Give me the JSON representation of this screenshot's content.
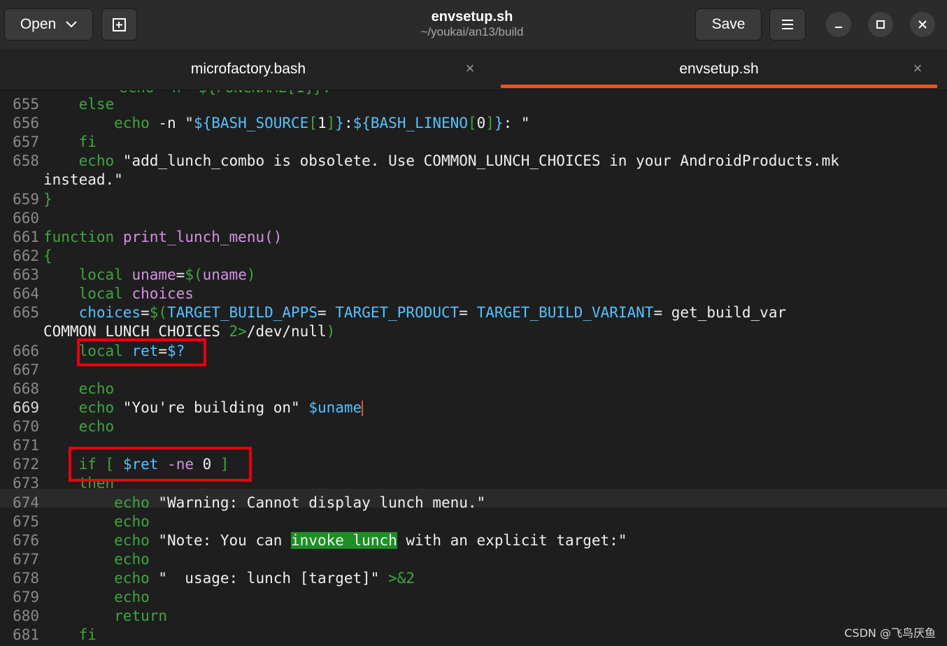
{
  "header": {
    "open_label": "Open",
    "new_tab_icon": "new-document-icon",
    "title": "envsetup.sh",
    "subtitle": "~/youkai/an13/build",
    "save_label": "Save",
    "menu_icon": "hamburger-menu-icon",
    "minimize_icon": "minimize-icon",
    "maximize_icon": "maximize-icon",
    "close_icon": "close-icon"
  },
  "tabs": [
    {
      "label": "microfactory.bash",
      "active": false
    },
    {
      "label": "envsetup.sh",
      "active": true
    }
  ],
  "colors": {
    "accent": "#e95420",
    "keyword": "#3fa63f",
    "variable": "#55c1ff",
    "function": "#d592e3",
    "highlight": "#1d8f24",
    "annotation": "#e8000e"
  },
  "editor": {
    "line_numbers": [
      "655",
      "656",
      "657",
      "658",
      "",
      "659",
      "660",
      "661",
      "662",
      "663",
      "664",
      "665",
      "",
      "666",
      "667",
      "668",
      "669",
      "670",
      "671",
      "672",
      "673",
      "674",
      "675",
      "676",
      "677",
      "678",
      "679",
      "680",
      "681"
    ],
    "current_line": "669"
  },
  "watermark": "CSDN @飞鸟厌鱼"
}
